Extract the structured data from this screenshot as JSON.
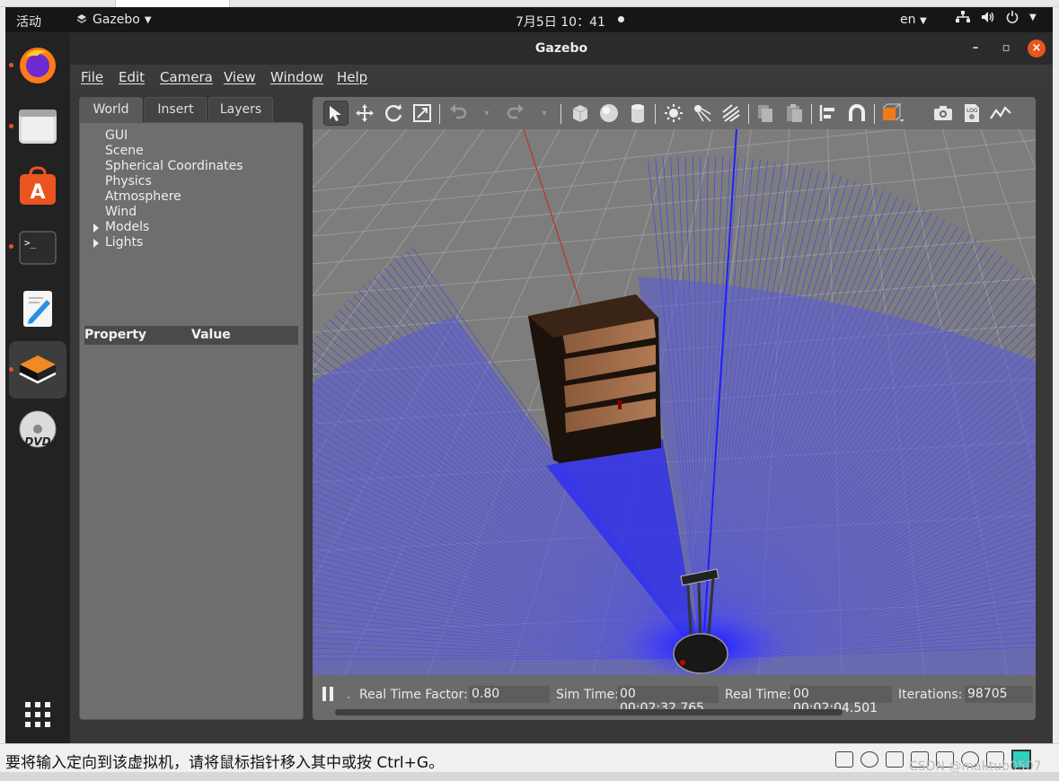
{
  "topbar": {
    "activities": "活动",
    "app_name": "Gazebo",
    "clock": "7月5日 10：41",
    "lang": "en"
  },
  "window": {
    "title": "Gazebo",
    "minimize": "–",
    "maximize": "▫",
    "close": "×"
  },
  "menubar": {
    "items": [
      "File",
      "Edit",
      "Camera",
      "View",
      "Window",
      "Help"
    ]
  },
  "left_panel": {
    "tabs": [
      "World",
      "Insert",
      "Layers"
    ],
    "selected_tab": "World",
    "tree": [
      "GUI",
      "Scene",
      "Spherical Coordinates",
      "Physics",
      "Atmosphere",
      "Wind",
      "Models",
      "Lights"
    ],
    "splitter": "......",
    "property_header": "Property",
    "value_header": "Value"
  },
  "toolbar": {
    "icons": [
      "select-arrow-icon",
      "translate-icon",
      "rotate-icon",
      "scale-icon",
      "undo-icon",
      "redo-icon",
      "box-icon",
      "sphere-icon",
      "cylinder-icon",
      "point-light-icon",
      "spot-light-icon",
      "directional-light-icon",
      "copy-icon",
      "paste-icon",
      "align-icon",
      "snap-icon",
      "view-angle-icon",
      "screenshot-icon",
      "log-icon",
      "plot-icon"
    ]
  },
  "statusbar": {
    "rtf_label": "Real Time Factor:",
    "rtf_value": "0.80",
    "sim_label": "Sim Time:",
    "sim_value": "00 00:02:32.765",
    "real_label": "Real Time:",
    "real_value": "00 00:02:04.501",
    "iter_label": "Iterations:",
    "iter_value": "98705"
  },
  "vm": {
    "message": "要将输入定向到该虚拟机，请将鼠标指针移入其中或按 Ctrl+G。",
    "watermark": "CSDN @maktub0507"
  },
  "colors": {
    "accent": "#e95420",
    "laser": "#3a3aff"
  }
}
